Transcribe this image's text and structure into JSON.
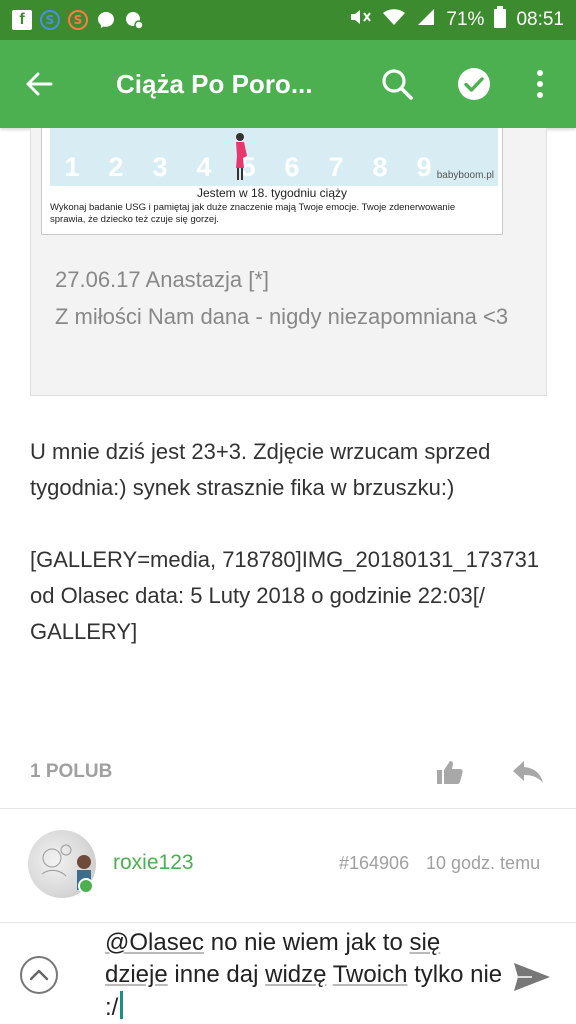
{
  "status_bar": {
    "icons_left": [
      "facebook-icon",
      "sync-blue-icon",
      "sync-orange-icon",
      "messenger-icon",
      "chat-icon"
    ],
    "battery": "71%",
    "time": "08:51"
  },
  "app_bar": {
    "title": "Ciąża Po Poro...",
    "actions": [
      "back-arrow-icon",
      "search-icon",
      "check-icon",
      "more-vert-icon"
    ]
  },
  "quote": {
    "banner": {
      "numbers": [
        "1",
        "2",
        "3",
        "4",
        "5",
        "6",
        "7",
        "8",
        "9"
      ],
      "site": "babyboom.pl",
      "heading": "Jestem w 18. tygodniu ciąży",
      "description": "Wykonaj badanie USG i pamiętaj jak duże znaczenie mają Twoje emocje. Twoje zdenerwowanie sprawia, że dziecko też czuje się gorzej."
    },
    "line1": "27.06.17 Anastazja [*]",
    "line2": "Z miłości Nam dana - nigdy niezapomniana <3"
  },
  "post": {
    "paragraph1": "U mnie dziś jest 23+3. Zdjęcie wrzucam sprzed tygodnia:) synek strasznie fika w brzuszku:)",
    "paragraph2": "[GALLERY=media, 718780]IMG_20180131_173731 od Olasec data: 5 Luty 2018 o godzinie 22:03[/ GALLERY]",
    "likes": "1 POLUB"
  },
  "next_post": {
    "author": "roxie123",
    "post_id": "#164906",
    "time": "10 godz. temu"
  },
  "composer": {
    "mention": "@Olasec",
    "text_part1": " no nie  wiem jak to ",
    "word_sie": "się",
    "text_part2": " ",
    "word_dzieje": "dzieje",
    "text_part3": " inne daj ",
    "word_widze": "widzę",
    "text_part4": " ",
    "word_twoich": "Twoich",
    "text_part5": " tylko nie :/"
  },
  "colors": {
    "status_bar": "#3d8b2f",
    "app_bar": "#4caf50",
    "accent": "#4caf50",
    "muted_text": "#a0a0a0"
  }
}
